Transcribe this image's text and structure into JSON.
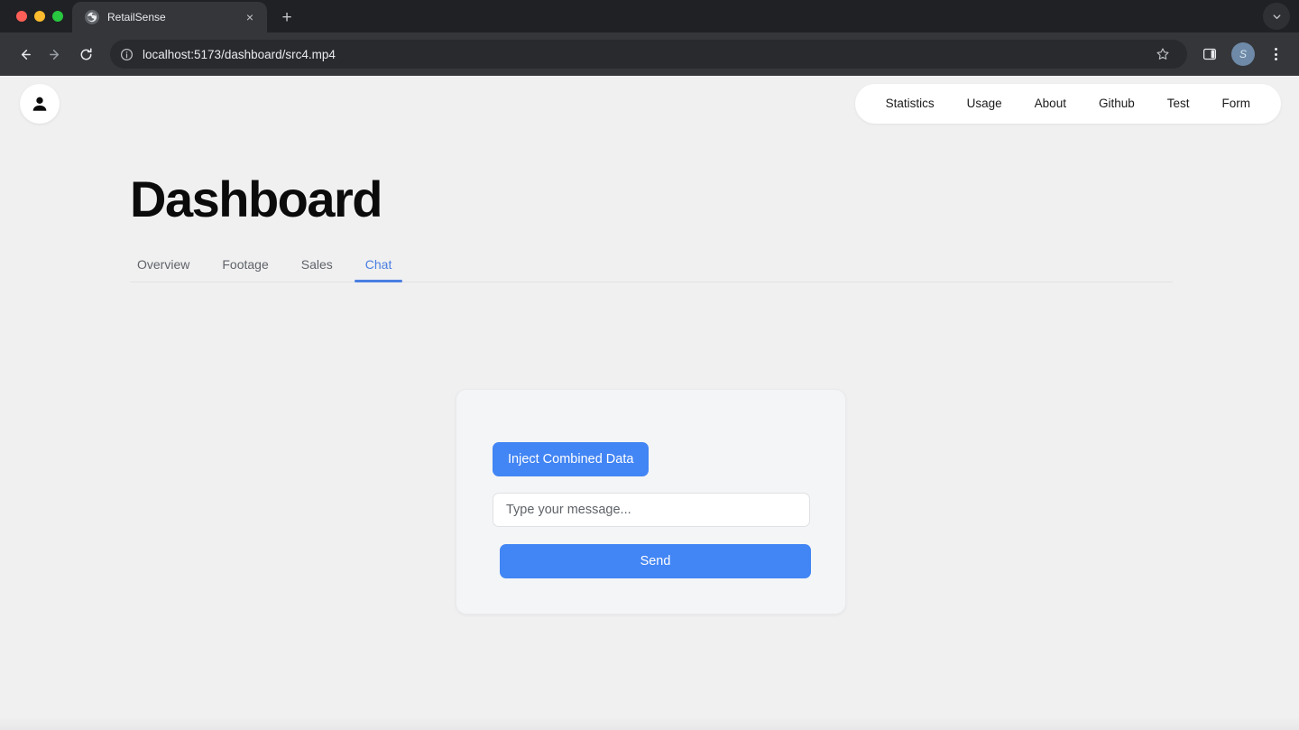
{
  "browser": {
    "traffic_lights": [
      "close",
      "minimize",
      "maximize"
    ],
    "tab": {
      "favicon": "globe-icon",
      "title": "RetailSense",
      "close_label": "×"
    },
    "new_tab_label": "+",
    "tabstrip_right_icon": "chevron-down-icon",
    "toolbar": {
      "back_icon": "back-arrow-icon",
      "forward_icon": "forward-arrow-icon",
      "reload_icon": "reload-icon",
      "site_info_icon": "info-circle-icon",
      "url": "localhost:5173/dashboard/src4.mp4",
      "bookmark_icon": "star-icon",
      "side_panel_icon": "side-panel-icon",
      "profile_initial": "S",
      "menu_icon": "kebab-menu-icon"
    }
  },
  "page": {
    "avatar_icon": "user-avatar-icon",
    "nav": {
      "items": [
        {
          "label": "Statistics"
        },
        {
          "label": "Usage"
        },
        {
          "label": "About"
        },
        {
          "label": "Github"
        },
        {
          "label": "Test"
        },
        {
          "label": "Form"
        }
      ]
    },
    "title": "Dashboard",
    "tabs": [
      {
        "label": "Overview",
        "active": false
      },
      {
        "label": "Footage",
        "active": false
      },
      {
        "label": "Sales",
        "active": false
      },
      {
        "label": "Chat",
        "active": true
      }
    ],
    "chat_card": {
      "inject_button_label": "Inject Combined Data",
      "message_input_value": "",
      "message_input_placeholder": "Type your message...",
      "send_button_label": "Send"
    }
  },
  "colors": {
    "accent_blue": "#4285f4",
    "active_tab_blue": "#4a7fe0",
    "page_background": "#f0f0f1",
    "card_background": "#f4f5f6",
    "chrome_dark": "#202124",
    "toolbar_dark": "#35363a"
  }
}
